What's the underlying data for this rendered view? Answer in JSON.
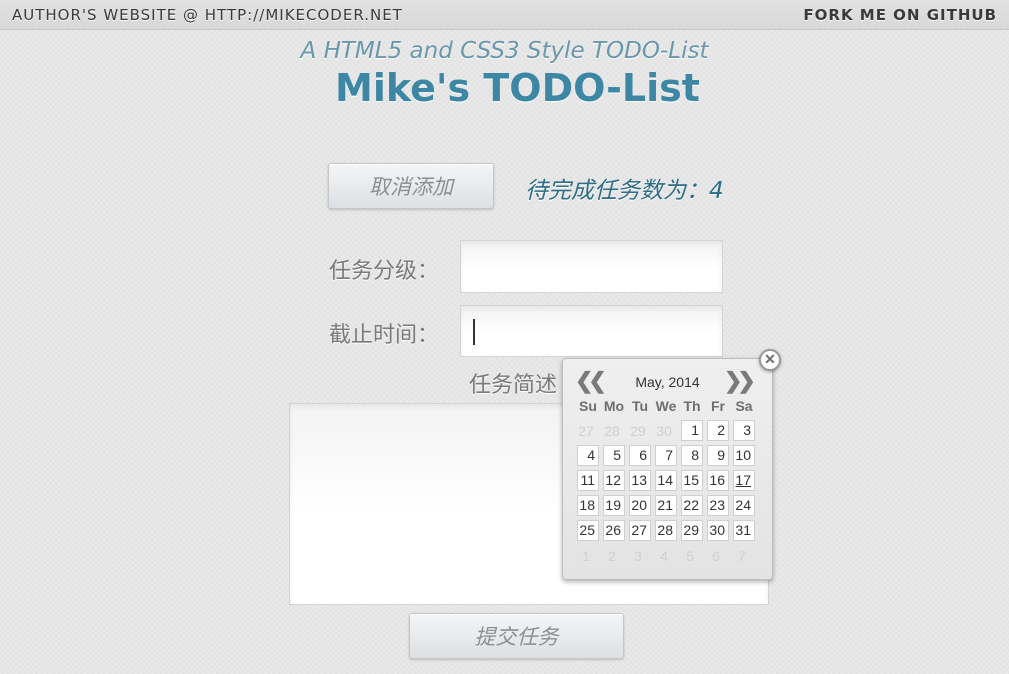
{
  "topbar": {
    "author_link": "AUTHOR'S WEBSITE @ HTTP://MIKECODER.NET",
    "github_link": "FORK ME ON GITHUB"
  },
  "header": {
    "subtitle": "A HTML5 and CSS3 Style TODO-List",
    "title": "Mike's TODO-List"
  },
  "toolbar": {
    "cancel_label": "取消添加",
    "pending_label": "待完成任务数为：",
    "pending_count": "4"
  },
  "form": {
    "level_label": "任务分级：",
    "level_value": "",
    "deadline_label": "截止时间：",
    "deadline_value": "",
    "desc_label": "任务简述",
    "desc_value": "",
    "submit_label": "提交任务"
  },
  "datepicker": {
    "prev_glyph": "❮❮",
    "next_glyph": "❯❯",
    "month_label": "May, 2014",
    "close_glyph": "✕",
    "weekdays": [
      "Su",
      "Mo",
      "Tu",
      "We",
      "Th",
      "Fr",
      "Sa"
    ],
    "today": "17",
    "weeks": [
      [
        {
          "d": "27",
          "o": true
        },
        {
          "d": "28",
          "o": true
        },
        {
          "d": "29",
          "o": true
        },
        {
          "d": "30",
          "o": true
        },
        {
          "d": "1"
        },
        {
          "d": "2"
        },
        {
          "d": "3"
        }
      ],
      [
        {
          "d": "4"
        },
        {
          "d": "5"
        },
        {
          "d": "6"
        },
        {
          "d": "7"
        },
        {
          "d": "8"
        },
        {
          "d": "9"
        },
        {
          "d": "10"
        }
      ],
      [
        {
          "d": "11"
        },
        {
          "d": "12"
        },
        {
          "d": "13"
        },
        {
          "d": "14"
        },
        {
          "d": "15"
        },
        {
          "d": "16"
        },
        {
          "d": "17"
        }
      ],
      [
        {
          "d": "18"
        },
        {
          "d": "19"
        },
        {
          "d": "20"
        },
        {
          "d": "21"
        },
        {
          "d": "22"
        },
        {
          "d": "23"
        },
        {
          "d": "24"
        }
      ],
      [
        {
          "d": "25"
        },
        {
          "d": "26"
        },
        {
          "d": "27"
        },
        {
          "d": "28"
        },
        {
          "d": "29"
        },
        {
          "d": "30"
        },
        {
          "d": "31"
        }
      ],
      [
        {
          "d": "1",
          "o": true
        },
        {
          "d": "2",
          "o": true
        },
        {
          "d": "3",
          "o": true
        },
        {
          "d": "4",
          "o": true
        },
        {
          "d": "5",
          "o": true
        },
        {
          "d": "6",
          "o": true
        },
        {
          "d": "7",
          "o": true
        }
      ]
    ]
  }
}
